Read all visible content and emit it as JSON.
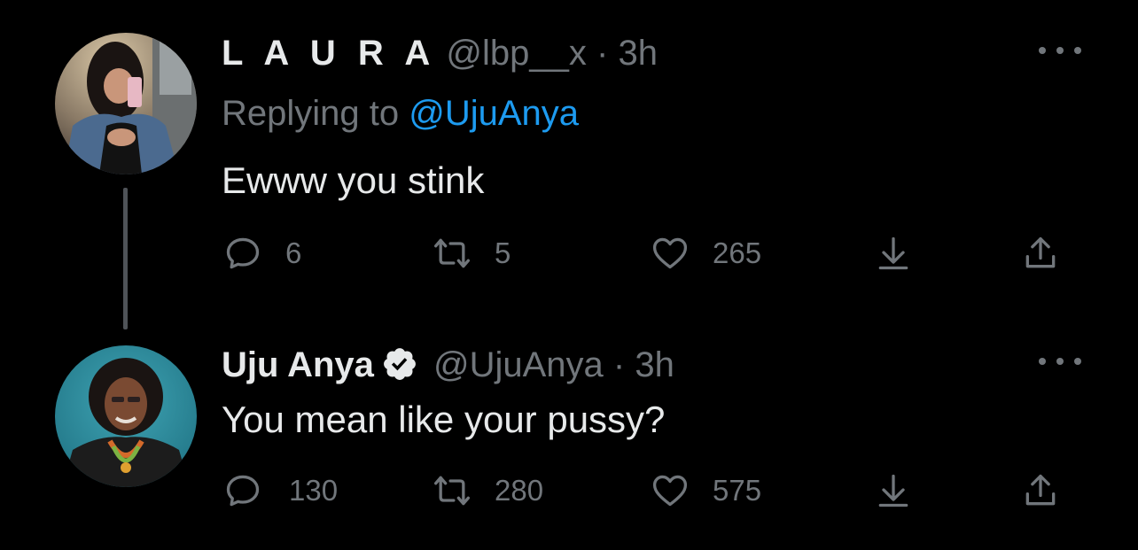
{
  "tweets": [
    {
      "display_name": "L A U R A",
      "handle": "@lbp__x",
      "separator": "·",
      "time": "3h",
      "replying_prefix": "Replying to",
      "replying_to": "@UjuAnya",
      "text": "Ewww you stink",
      "replies": "6",
      "retweets": "5",
      "likes": "265",
      "verified": false
    },
    {
      "display_name": "Uju Anya",
      "handle": "@UjuAnya",
      "separator": "·",
      "time": "3h",
      "text": "You mean like your pussy?",
      "replies": "130",
      "retweets": "280",
      "likes": "575",
      "verified": true
    }
  ],
  "icons": {
    "reply": "reply-icon",
    "retweet": "retweet-icon",
    "like": "heart-icon",
    "download": "download-icon",
    "share": "share-icon",
    "more": "more-icon",
    "verified": "verified-badge-icon"
  },
  "colors": {
    "background": "#000000",
    "text_primary": "#e7e9ea",
    "text_secondary": "#71767b",
    "link": "#1d9bf0"
  }
}
